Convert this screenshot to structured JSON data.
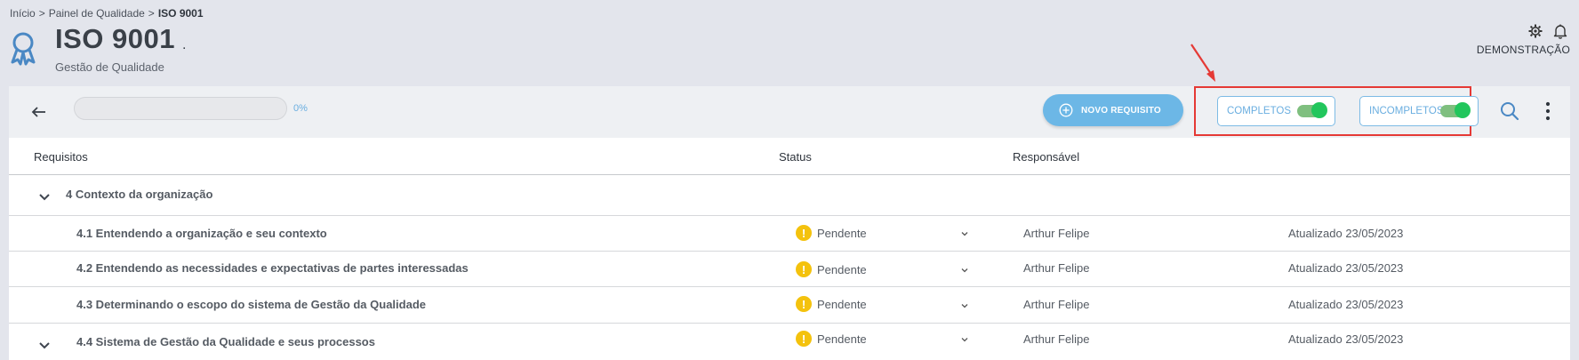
{
  "breadcrumb": {
    "items": [
      "Início",
      "Painel de Qualidade",
      "ISO 9001"
    ],
    "separator": ">"
  },
  "header": {
    "title": "ISO 9001",
    "title_suffix": ".",
    "subtitle": "Gestão de Qualidade"
  },
  "top_right": {
    "user_label": "DEMONSTRAÇÃO",
    "icons": [
      "gear-icon",
      "bell-icon"
    ]
  },
  "toolbar": {
    "progress_percent": 0,
    "progress_label": "0%",
    "new_requirement_label": "NOVO REQUISITO",
    "toggle_completos": {
      "label": "COMPLETOS",
      "on": true
    },
    "toggle_incompletos": {
      "label": "INCOMPLETOS",
      "on": true
    }
  },
  "table": {
    "columns": [
      "Requisitos",
      "Status",
      "Responsável"
    ],
    "rows": [
      {
        "type": "group",
        "requirement": "4 Contexto da organização"
      },
      {
        "type": "item",
        "requirement": "4.1 Entendendo a organização e seu contexto",
        "status": "Pendente",
        "responsible": "Arthur Felipe",
        "updated": "Atualizado 23/05/2023"
      },
      {
        "type": "item",
        "requirement": "4.2 Entendendo as necessidades e expectativas de partes interessadas",
        "status": "Pendente",
        "responsible": "Arthur Felipe",
        "updated": "Atualizado 23/05/2023"
      },
      {
        "type": "item",
        "requirement": "4.3 Determinando o escopo do sistema de Gestão da Qualidade",
        "status": "Pendente",
        "responsible": "Arthur Felipe",
        "updated": "Atualizado 23/05/2023"
      },
      {
        "type": "item-expandable",
        "requirement": "4.4 Sistema de Gestão da Qualidade e seus processos",
        "status": "Pendente",
        "responsible": "Arthur Felipe",
        "updated": "Atualizado 23/05/2023"
      }
    ]
  },
  "colors": {
    "accent": "#6cb7e6",
    "toggle_on": "#22c65c",
    "warning": "#f4c20d",
    "annotation": "#e53935"
  }
}
